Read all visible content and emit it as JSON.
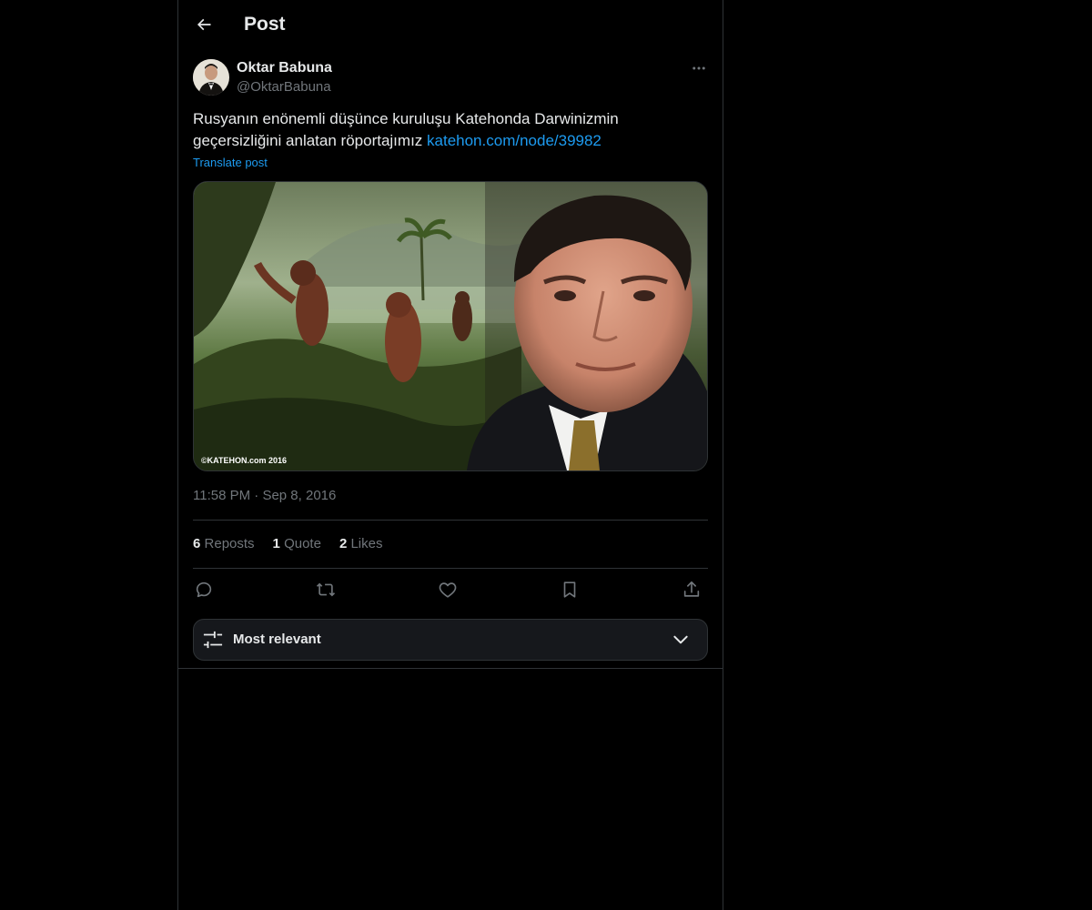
{
  "header": {
    "title": "Post"
  },
  "post": {
    "author_name": "Oktar Babuna",
    "author_handle": "@OktarBabuna",
    "text": "Rusyanın enönemli düşünce kuruluşu Katehonda Darwinizmin geçersizliğini anlatan röportajımız ",
    "link": "katehon.com/node/39982",
    "translate_label": "Translate post",
    "media_caption": "©KATEHON.com 2016",
    "time": "11:58 PM",
    "separator": "·",
    "date": "Sep 8, 2016"
  },
  "stats": {
    "reposts_count": "6",
    "reposts_label": "Reposts",
    "quote_count": "1",
    "quote_label": "Quote",
    "likes_count": "2",
    "likes_label": "Likes"
  },
  "sort": {
    "label": "Most relevant"
  },
  "colors": {
    "background": "#000000",
    "text": "#e7e9ea",
    "muted": "#71767b",
    "accent": "#1d9bf0",
    "border": "#2f3336"
  },
  "icons": {
    "back": "arrow-left-icon",
    "more": "more-horizontal-icon",
    "reply": "reply-icon",
    "repost": "repost-icon",
    "like": "heart-icon",
    "bookmark": "bookmark-icon",
    "share": "share-icon",
    "sort": "sliders-icon",
    "chevron": "chevron-down-icon"
  }
}
